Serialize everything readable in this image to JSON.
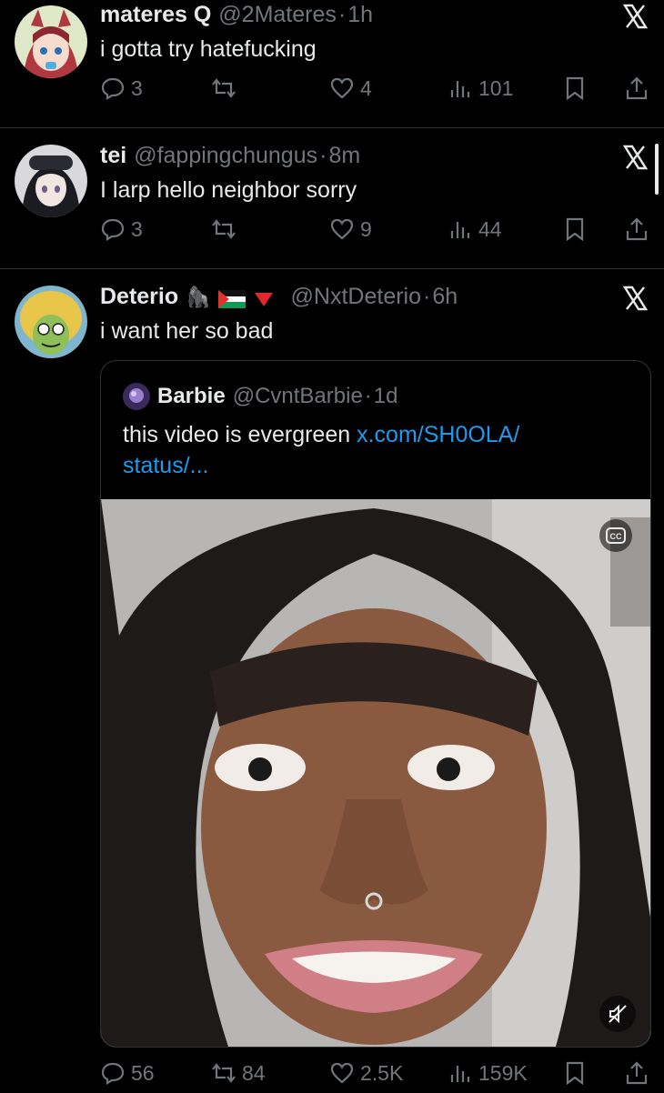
{
  "tweets": [
    {
      "name": "materes Q",
      "handle": "@2Materes",
      "sep": "·",
      "time": "1h",
      "text": "i gotta try hatefucking",
      "replies": "3",
      "reposts": "",
      "likes": "4",
      "views": "101"
    },
    {
      "name": "tei",
      "handle": "@fappingchungus",
      "sep": "·",
      "time": "8m",
      "text": "I larp hello neighbor sorry",
      "replies": "3",
      "reposts": "",
      "likes": "9",
      "views": "44"
    },
    {
      "name": "Deterio",
      "emoji": "🦍",
      "handle": "@NxtDeterio",
      "sep": "·",
      "time": "6h",
      "text": "i want her so bad",
      "replies": "56",
      "reposts": "84",
      "likes": "2.5K",
      "views": "159K"
    }
  ],
  "quote": {
    "name": "Barbie",
    "handle": "@CvntBarbie",
    "sep": "·",
    "time": "1d",
    "text": "this video is evergreen ",
    "link": "x.com/SH0OLA/",
    "link2": "status/...",
    "cc_label": "CC"
  },
  "icons": [
    "x-logo-icon",
    "reply-icon",
    "repost-icon",
    "like-icon",
    "views-icon",
    "bookmark-icon",
    "share-icon",
    "closed-captions-icon",
    "mute-icon"
  ],
  "colors": {
    "background": "#000000",
    "text": "#e7e9ea",
    "secondary": "#71767b",
    "link": "#1d9bf0",
    "divider": "#2f3336"
  }
}
